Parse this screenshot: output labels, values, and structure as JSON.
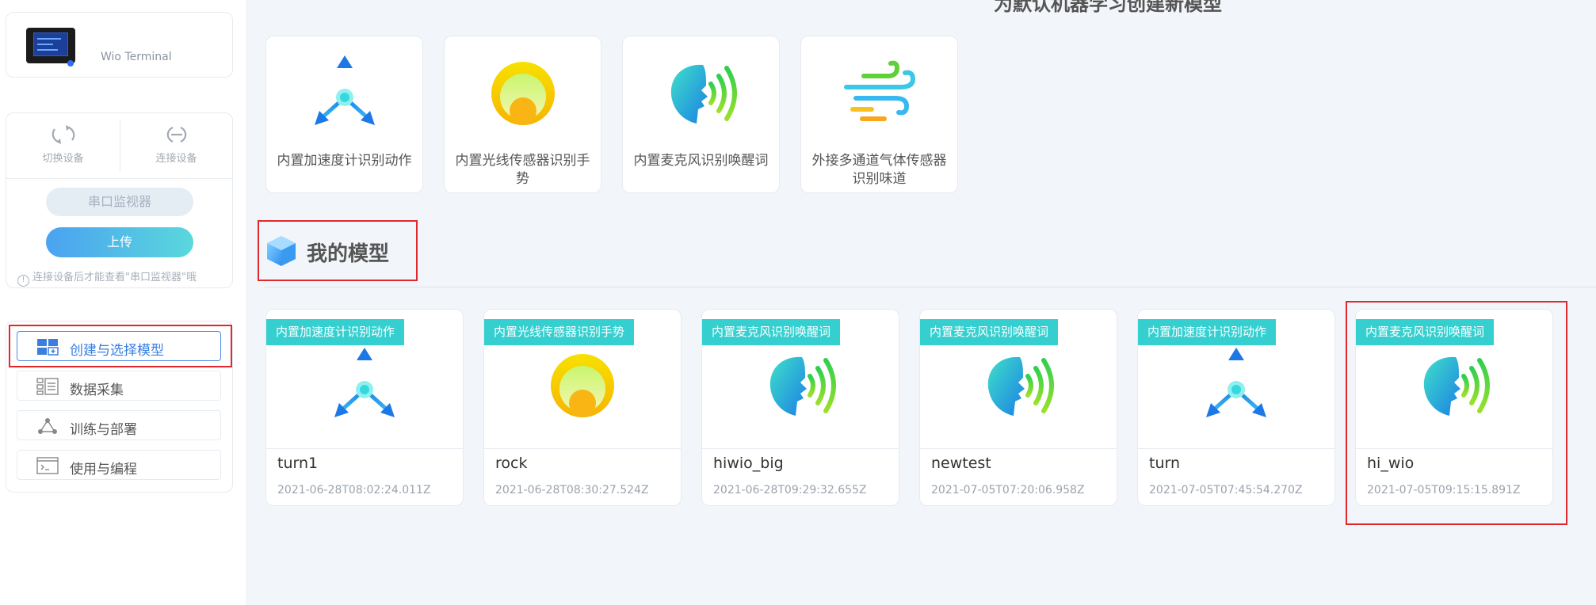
{
  "device": {
    "name": "Wio Terminal"
  },
  "controls": {
    "switch_label": "切换设备",
    "connect_label": "连接设备",
    "serial_label": "串口监视器",
    "upload_label": "上传",
    "hint": "连接设备后才能查看\"串口监视器\"哦"
  },
  "nav": [
    {
      "label": "创建与选择模型",
      "icon": "grid-add-icon",
      "active": true
    },
    {
      "label": "数据采集",
      "icon": "list-icon"
    },
    {
      "label": "训练与部署",
      "icon": "network-icon"
    },
    {
      "label": "使用与编程",
      "icon": "terminal-icon"
    }
  ],
  "top_title": "为默认机器学习创建新模型",
  "templates": [
    {
      "label": "内置加速度计识别动作",
      "icon": "accelerometer-icon"
    },
    {
      "label": "内置光线传感器识别手势",
      "icon": "light-sensor-icon"
    },
    {
      "label": "内置麦克风识别唤醒词",
      "icon": "microphone-voice-icon"
    },
    {
      "label": "外接多通道气体传感器识别味道",
      "icon": "gas-sensor-icon"
    }
  ],
  "my_models": {
    "title": "我的模型",
    "items": [
      {
        "tag": "内置加速度计识别动作",
        "name": "turn1",
        "date": "2021-06-28T08:02:24.011Z",
        "icon": "accelerometer-icon"
      },
      {
        "tag": "内置光线传感器识别手势",
        "name": "rock",
        "date": "2021-06-28T08:30:27.524Z",
        "icon": "light-sensor-icon"
      },
      {
        "tag": "内置麦克风识别唤醒词",
        "name": "hiwio_big",
        "date": "2021-06-28T09:29:32.655Z",
        "icon": "microphone-voice-icon"
      },
      {
        "tag": "内置麦克风识别唤醒词",
        "name": "newtest",
        "date": "2021-07-05T07:20:06.958Z",
        "icon": "microphone-voice-icon"
      },
      {
        "tag": "内置加速度计识别动作",
        "name": "turn",
        "date": "2021-07-05T07:45:54.270Z",
        "icon": "accelerometer-icon"
      },
      {
        "tag": "内置麦克风识别唤醒词",
        "name": "hi_wio",
        "date": "2021-07-05T09:15:15.891Z",
        "icon": "microphone-voice-icon"
      }
    ]
  },
  "colors": {
    "accent": "#3a7fe0",
    "tag": "#35cfd0",
    "highlight": "#e0282e"
  }
}
